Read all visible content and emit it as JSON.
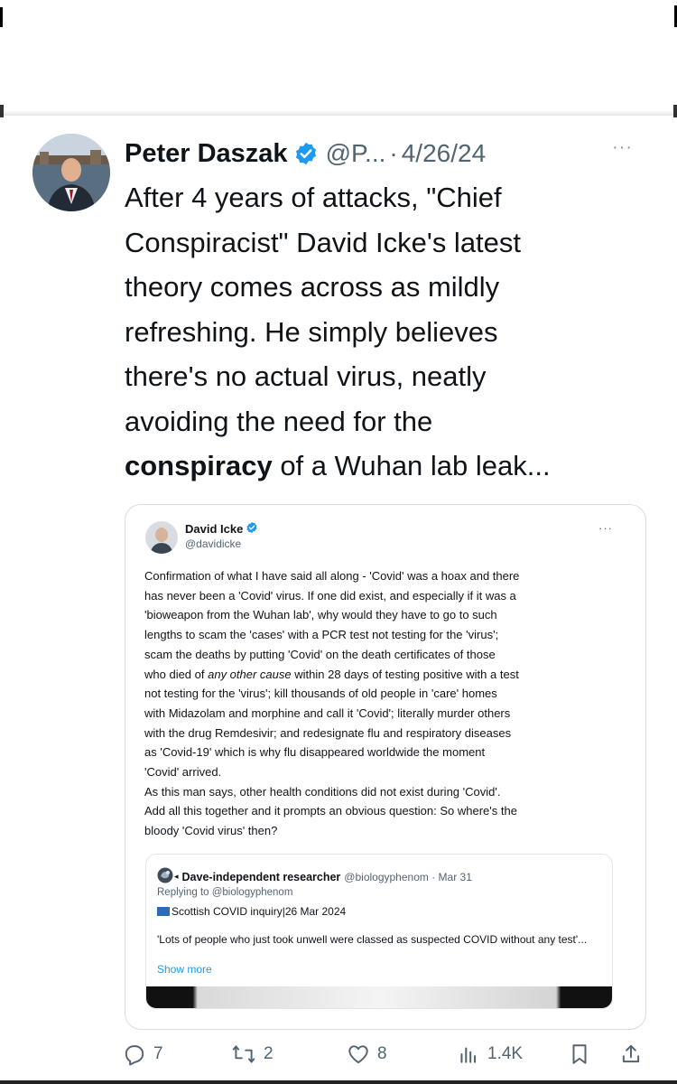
{
  "post": {
    "author_name": "Peter Daszak",
    "handle": "@P...",
    "separator": "·",
    "date": "4/26/24",
    "text_lines": [
      "After 4 years of attacks, \"Chief",
      "Conspiracist\" David Icke's latest",
      "theory comes across as mildly",
      "refreshing. He simply believes",
      "there's no actual virus, neatly",
      "avoiding the need for the"
    ],
    "last_line_bold": "conspiracy",
    "last_line_rest": " of a Wuhan lab leak..."
  },
  "quote": {
    "author_name": "David Icke",
    "handle": "@davidicke",
    "body_lines": [
      "Confirmation of what I have said all along - 'Covid' was a hoax and there",
      "has never been a 'Covid' virus. If one did exist, and especially if it was a",
      "'bioweapon from the Wuhan lab', why would they have to go to such",
      "lengths to scam the 'cases' with a PCR test not testing for the 'virus';",
      "scam the deaths by putting 'Covid' on the death certificates of those"
    ],
    "line6_before": "who died of ",
    "line6_italic": "any other cause",
    "line6_after": " within 28 days of testing positive with a test",
    "body_lines_2": [
      "not testing for the 'virus'; kill thousands of old people in 'care' homes",
      "with Midazolam and morphine and call it 'Covid'; literally murder others",
      "with the drug Remdesivir; and redesignate flu and respiratory diseases",
      "as 'Covid-19' which is why flu disappeared worldwide the moment",
      "'Covid' arrived.",
      "As this man says, other health conditions did not exist during 'Covid'.",
      "Add all this together and it prompts an obvious question: So where's the",
      "bloody 'Covid virus' then?"
    ],
    "inner": {
      "author_name": "Dave-independent researcher",
      "handle_date": "@biologyphenom · Mar 31",
      "replying": "Replying to @biologyphenom",
      "source": "Scottish COVID inquiry|26 Mar 2024",
      "quote_text": "'Lots of people who just took unwell were classed as suspected COVID without any test'...",
      "show_more": "Show more"
    }
  },
  "actions": {
    "replies": "7",
    "reposts": "2",
    "likes": "8",
    "views": "1.4K"
  },
  "colors": {
    "verified_blue": "#1d9bf0",
    "text": "#0f1419",
    "muted": "#536471"
  }
}
